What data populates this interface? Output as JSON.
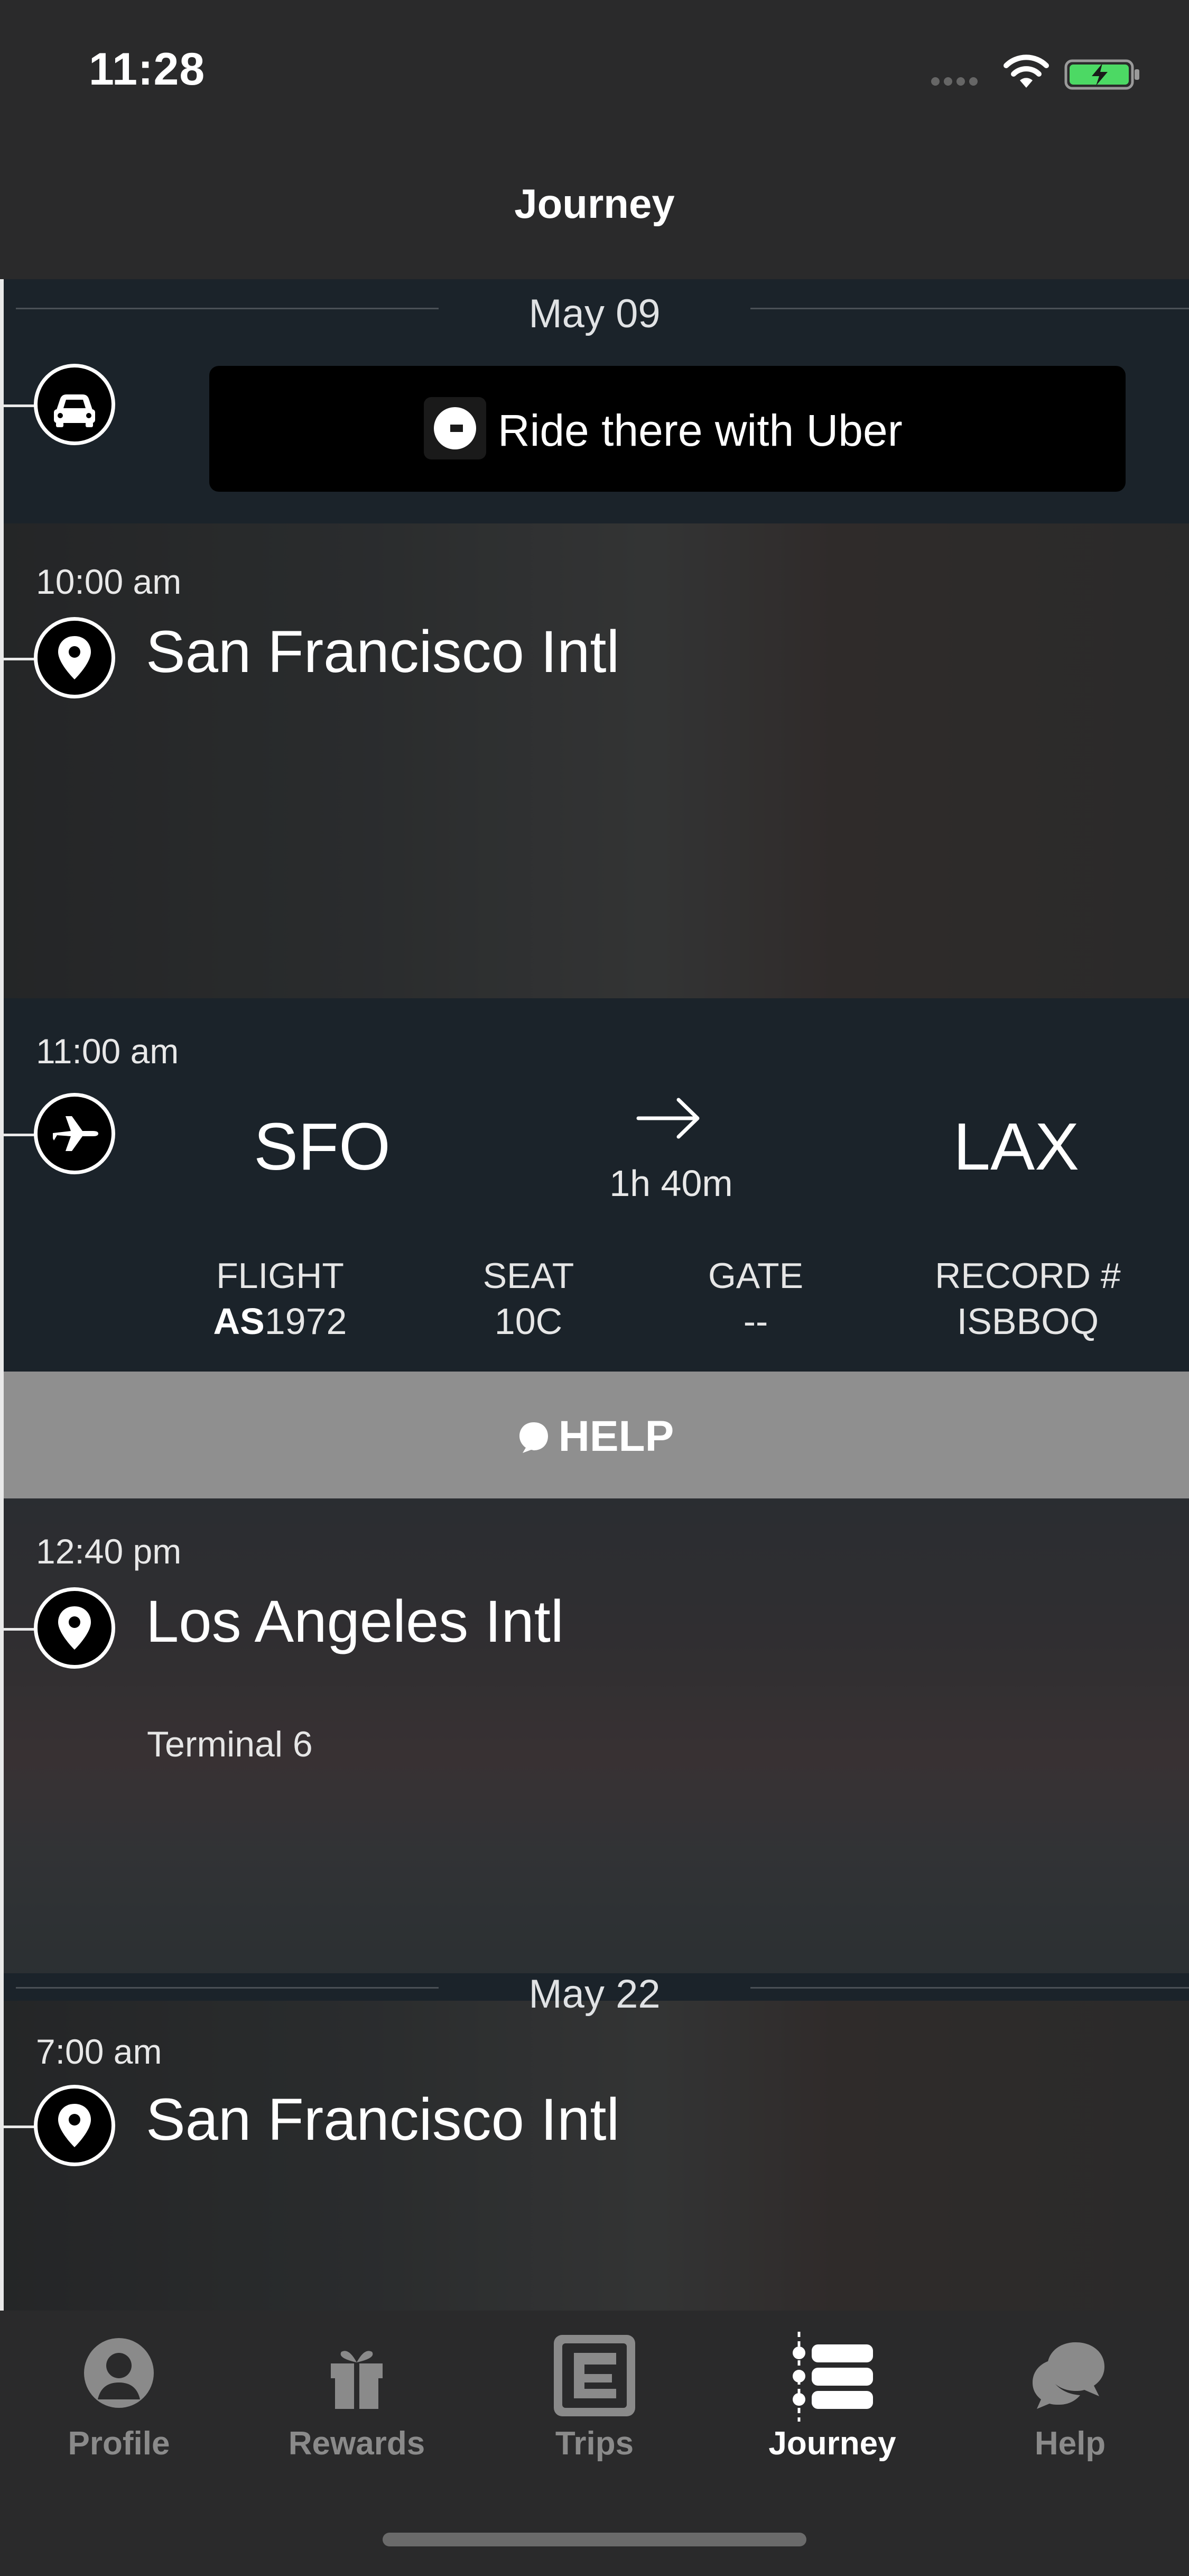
{
  "status_bar": {
    "time": "11:28"
  },
  "nav": {
    "title": "Journey"
  },
  "timeline": {
    "dates": [
      "May 09",
      "May 22"
    ],
    "uber_button_label": "Ride there with Uber",
    "stops": [
      {
        "time": "10:00 am",
        "place": "San Francisco Intl"
      },
      {
        "time": "12:40 pm",
        "place": "Los Angeles Intl",
        "terminal": "Terminal 6"
      },
      {
        "time": "7:00 am",
        "place": "San Francisco Intl"
      }
    ],
    "flight": {
      "time": "11:00 am",
      "origin": "SFO",
      "destination": "LAX",
      "duration": "1h 40m",
      "flight_label": "FLIGHT",
      "airline_code": "AS",
      "flight_number": "1972",
      "seat_label": "SEAT",
      "seat": "10C",
      "gate_label": "GATE",
      "gate": "--",
      "record_label": "RECORD #",
      "record": "ISBBOQ"
    },
    "help_label": "HELP"
  },
  "tab_bar": {
    "tabs": [
      {
        "label": "Profile",
        "icon": "profile-icon"
      },
      {
        "label": "Rewards",
        "icon": "gift-icon"
      },
      {
        "label": "Trips",
        "icon": "trips-icon"
      },
      {
        "label": "Journey",
        "icon": "journey-icon",
        "active": true
      },
      {
        "label": "Help",
        "icon": "chat-bubbles-icon"
      }
    ]
  },
  "colors": {
    "background": "#2a2a2b",
    "timeline_bg": "#151c22",
    "help_bar": "#8f8f8f",
    "battery_green": "#4cd964",
    "tab_inactive": "#8a8a8a"
  }
}
